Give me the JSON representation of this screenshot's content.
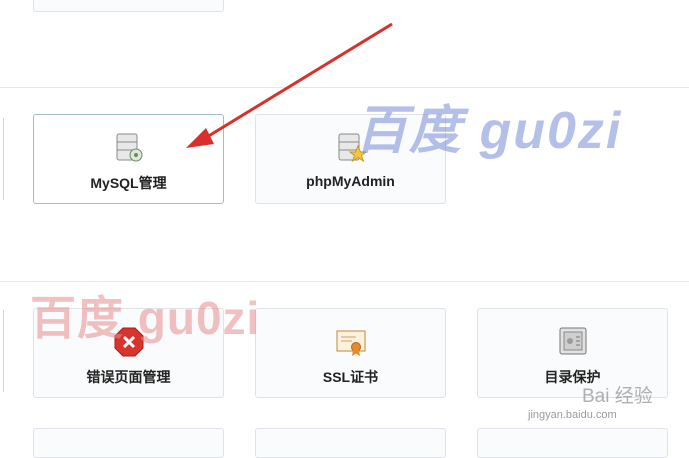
{
  "tiles": {
    "mysql": {
      "label": "MySQL管理",
      "icon": "database-gear-icon"
    },
    "phpmyadmin": {
      "label": "phpMyAdmin",
      "icon": "database-star-icon"
    },
    "error_pages": {
      "label": "错误页面管理",
      "icon": "error-x-icon"
    },
    "ssl": {
      "label": "SSL证书",
      "icon": "certificate-icon"
    },
    "dir_protect": {
      "label": "目录保护",
      "icon": "safe-icon"
    }
  },
  "watermarks": {
    "blue": "百度 gu0zi",
    "red": "百度  gu0zi",
    "logo": "Bai 经验",
    "site": "jingyan.baidu.com"
  },
  "colors": {
    "arrow": "#d9302c",
    "tile_border": "#dfe3e8",
    "tile_active_border": "#9fbcd0"
  }
}
